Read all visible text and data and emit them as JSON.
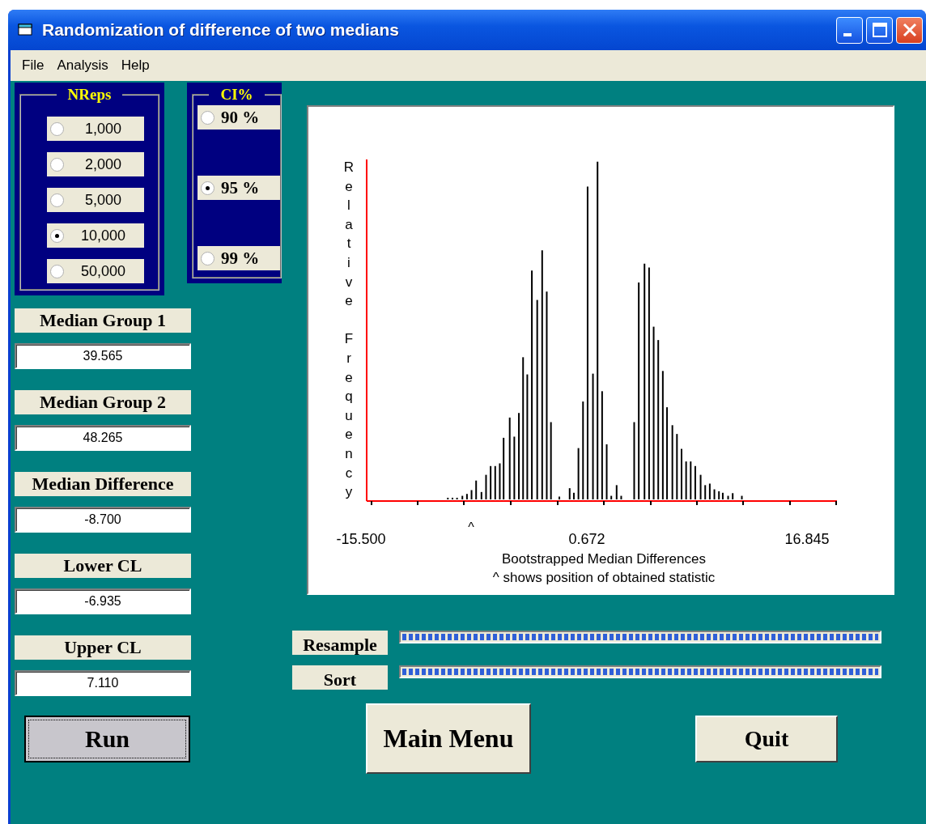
{
  "window": {
    "title": "Randomization of difference of two medians"
  },
  "menu": [
    {
      "label": "File"
    },
    {
      "label": "Analysis"
    },
    {
      "label": "Help"
    }
  ],
  "nreps": {
    "title": "NReps",
    "options": [
      {
        "label": "1,000",
        "selected": false
      },
      {
        "label": "2,000",
        "selected": false
      },
      {
        "label": "5,000",
        "selected": false
      },
      {
        "label": "10,000",
        "selected": true
      },
      {
        "label": "50,000",
        "selected": false
      }
    ]
  },
  "ci": {
    "title": "CI%",
    "options": [
      {
        "label": "90 %",
        "selected": false
      },
      {
        "label": "95 %",
        "selected": true
      },
      {
        "label": "99 %",
        "selected": false
      }
    ]
  },
  "stats": [
    {
      "label": "Median Group 1",
      "value": "39.565"
    },
    {
      "label": "Median Group 2",
      "value": "48.265"
    },
    {
      "label": "Median Difference",
      "value": "-8.700"
    },
    {
      "label": "Lower CL",
      "value": "-6.935"
    },
    {
      "label": "Upper CL",
      "value": "7.110"
    }
  ],
  "chart": {
    "ylabel": "Relative Frequency",
    "xticks": [
      "-15.500",
      "0.672",
      "16.845"
    ],
    "marker": "^",
    "xlabel": "Bootstrapped Median Differences",
    "note": "^ shows position of obtained statistic"
  },
  "progress": [
    {
      "label": "Resample",
      "level": 1
    },
    {
      "label": "Sort",
      "level": 1
    }
  ],
  "buttons": [
    {
      "label": "Run",
      "focused": true
    },
    {
      "label": "Main Menu",
      "focused": false
    },
    {
      "label": "Quit",
      "focused": false
    }
  ]
}
